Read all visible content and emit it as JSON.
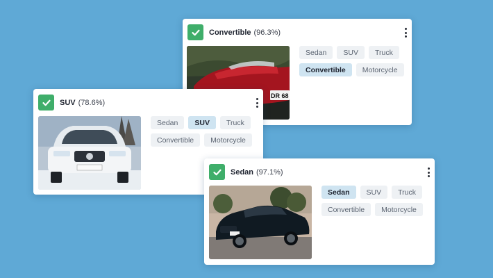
{
  "colors": {
    "background": "#5fa9d6",
    "check": "#3fae6a",
    "chip_bg": "#eef1f4",
    "chip_selected_bg": "#cfe4f1"
  },
  "cards": {
    "convertible": {
      "label": "Convertible",
      "confidence": "(96.3%)",
      "image": "red-convertible-photo",
      "chips": {
        "sedan": "Sedan",
        "suv": "SUV",
        "truck": "Truck",
        "convertible": "Convertible",
        "motorcycle": "Motorcycle"
      },
      "selected": "Convertible",
      "plate_text": "DR 68"
    },
    "suv": {
      "label": "SUV",
      "confidence": "(78.6%)",
      "image": "white-suv-photo",
      "chips": {
        "sedan": "Sedan",
        "suv": "SUV",
        "truck": "Truck",
        "convertible": "Convertible",
        "motorcycle": "Motorcycle"
      },
      "selected": "SUV"
    },
    "sedan": {
      "label": "Sedan",
      "confidence": "(97.1%)",
      "image": "black-sedan-photo",
      "chips": {
        "sedan": "Sedan",
        "suv": "SUV",
        "truck": "Truck",
        "convertible": "Convertible",
        "motorcycle": "Motorcycle"
      },
      "selected": "Sedan"
    }
  }
}
